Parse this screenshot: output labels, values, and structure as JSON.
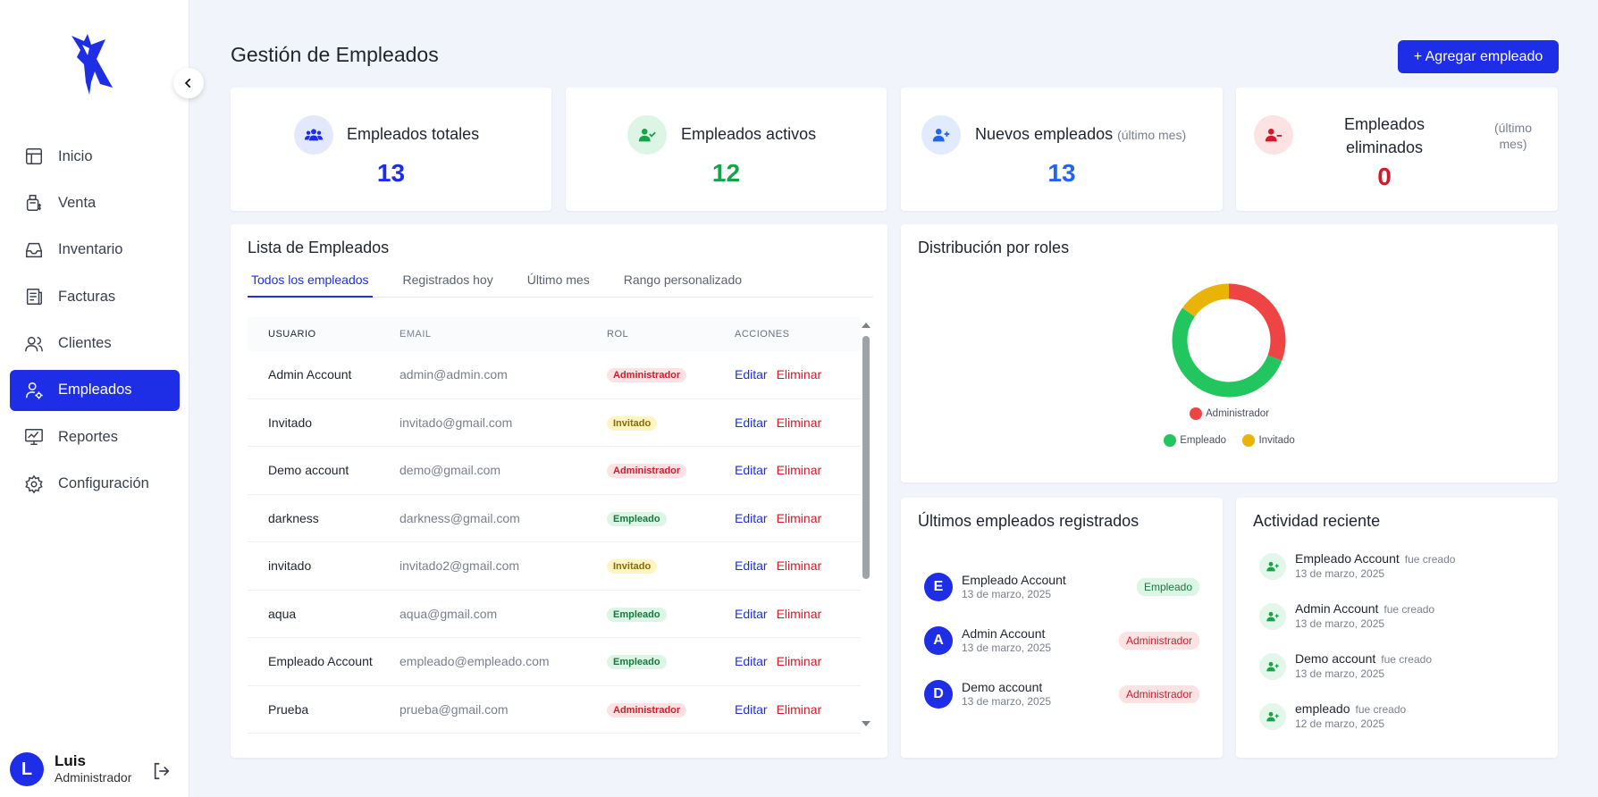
{
  "sidebar": {
    "items": [
      {
        "label": "Inicio",
        "icon": "layout-icon"
      },
      {
        "label": "Venta",
        "icon": "register-icon"
      },
      {
        "label": "Inventario",
        "icon": "inbox-icon"
      },
      {
        "label": "Facturas",
        "icon": "invoice-icon"
      },
      {
        "label": "Clientes",
        "icon": "users-icon"
      },
      {
        "label": "Empleados",
        "icon": "user-gear-icon"
      },
      {
        "label": "Reportes",
        "icon": "monitor-chart-icon"
      },
      {
        "label": "Configuración",
        "icon": "gear-icon"
      }
    ],
    "active_index": 5,
    "user": {
      "initial": "L",
      "name": "Luis",
      "role": "Administrador"
    }
  },
  "header": {
    "title": "Gestión de Empleados",
    "add_button": "+ Agregar empleado"
  },
  "stats": {
    "total": {
      "label": "Empleados totales",
      "value": "13",
      "color": "#1d2ee6"
    },
    "active": {
      "label": "Empleados activos",
      "value": "12",
      "color": "#17a34a"
    },
    "new": {
      "label": "Nuevos empleados",
      "sub": "(último mes)",
      "value": "13",
      "color": "#2266e6"
    },
    "deleted": {
      "label_line1": "Empleados",
      "label_line2": "eliminados",
      "sub_line1": "(último",
      "sub_line2": "mes)",
      "value": "0",
      "color": "#d11a2a"
    }
  },
  "employee_list": {
    "title": "Lista de Empleados",
    "tabs": [
      "Todos los empleados",
      "Registrados hoy",
      "Último mes",
      "Rango personalizado"
    ],
    "columns": [
      "USUARIO",
      "EMAIL",
      "ROL",
      "ACCIONES"
    ],
    "edit_label": "Editar",
    "delete_label": "Eliminar",
    "rows": [
      {
        "user": "Admin Account",
        "email": "admin@admin.com",
        "role": "Administrador"
      },
      {
        "user": "Invitado",
        "email": "invitado@gmail.com",
        "role": "Invitado"
      },
      {
        "user": "Demo account",
        "email": "demo@gmail.com",
        "role": "Administrador"
      },
      {
        "user": "darkness",
        "email": "darkness@gmail.com",
        "role": "Empleado"
      },
      {
        "user": "invitado",
        "email": "invitado2@gmail.com",
        "role": "Invitado"
      },
      {
        "user": "aqua",
        "email": "aqua@gmail.com",
        "role": "Empleado"
      },
      {
        "user": "Empleado Account",
        "email": "empleado@empleado.com",
        "role": "Empleado"
      },
      {
        "user": "Prueba",
        "email": "prueba@gmail.com",
        "role": "Administrador"
      }
    ]
  },
  "roles_chart": {
    "title": "Distribución por roles"
  },
  "chart_data": {
    "type": "pie",
    "donut": true,
    "categories": [
      "Administrador",
      "Empleado",
      "Invitado"
    ],
    "values": [
      4,
      7,
      2
    ],
    "colors": [
      "#ef4444",
      "#22c55e",
      "#eab308"
    ],
    "legend_position": "bottom"
  },
  "latest": {
    "title": "Últimos empleados registrados",
    "items": [
      {
        "initial": "E",
        "name": "Empleado Account",
        "date": "13 de marzo, 2025",
        "role": "Empleado"
      },
      {
        "initial": "A",
        "name": "Admin Account",
        "date": "13 de marzo, 2025",
        "role": "Administrador"
      },
      {
        "initial": "D",
        "name": "Demo account",
        "date": "13 de marzo, 2025",
        "role": "Administrador"
      }
    ]
  },
  "activity": {
    "title": "Actividad reciente",
    "items": [
      {
        "name": "Empleado Account",
        "verb": "fue creado",
        "date": "13 de marzo, 2025"
      },
      {
        "name": "Admin Account",
        "verb": "fue creado",
        "date": "13 de marzo, 2025"
      },
      {
        "name": "Demo account",
        "verb": "fue creado",
        "date": "13 de marzo, 2025"
      },
      {
        "name": "empleado",
        "verb": "fue creado",
        "date": "12 de marzo, 2025"
      }
    ]
  },
  "role_styles": {
    "Administrador": {
      "bg": "#fde2e4",
      "fg": "#c81e2e"
    },
    "Invitado": {
      "bg": "#fef5c3",
      "fg": "#8a6a00"
    },
    "Empleado": {
      "bg": "#dcf5e5",
      "fg": "#167a3e"
    }
  }
}
